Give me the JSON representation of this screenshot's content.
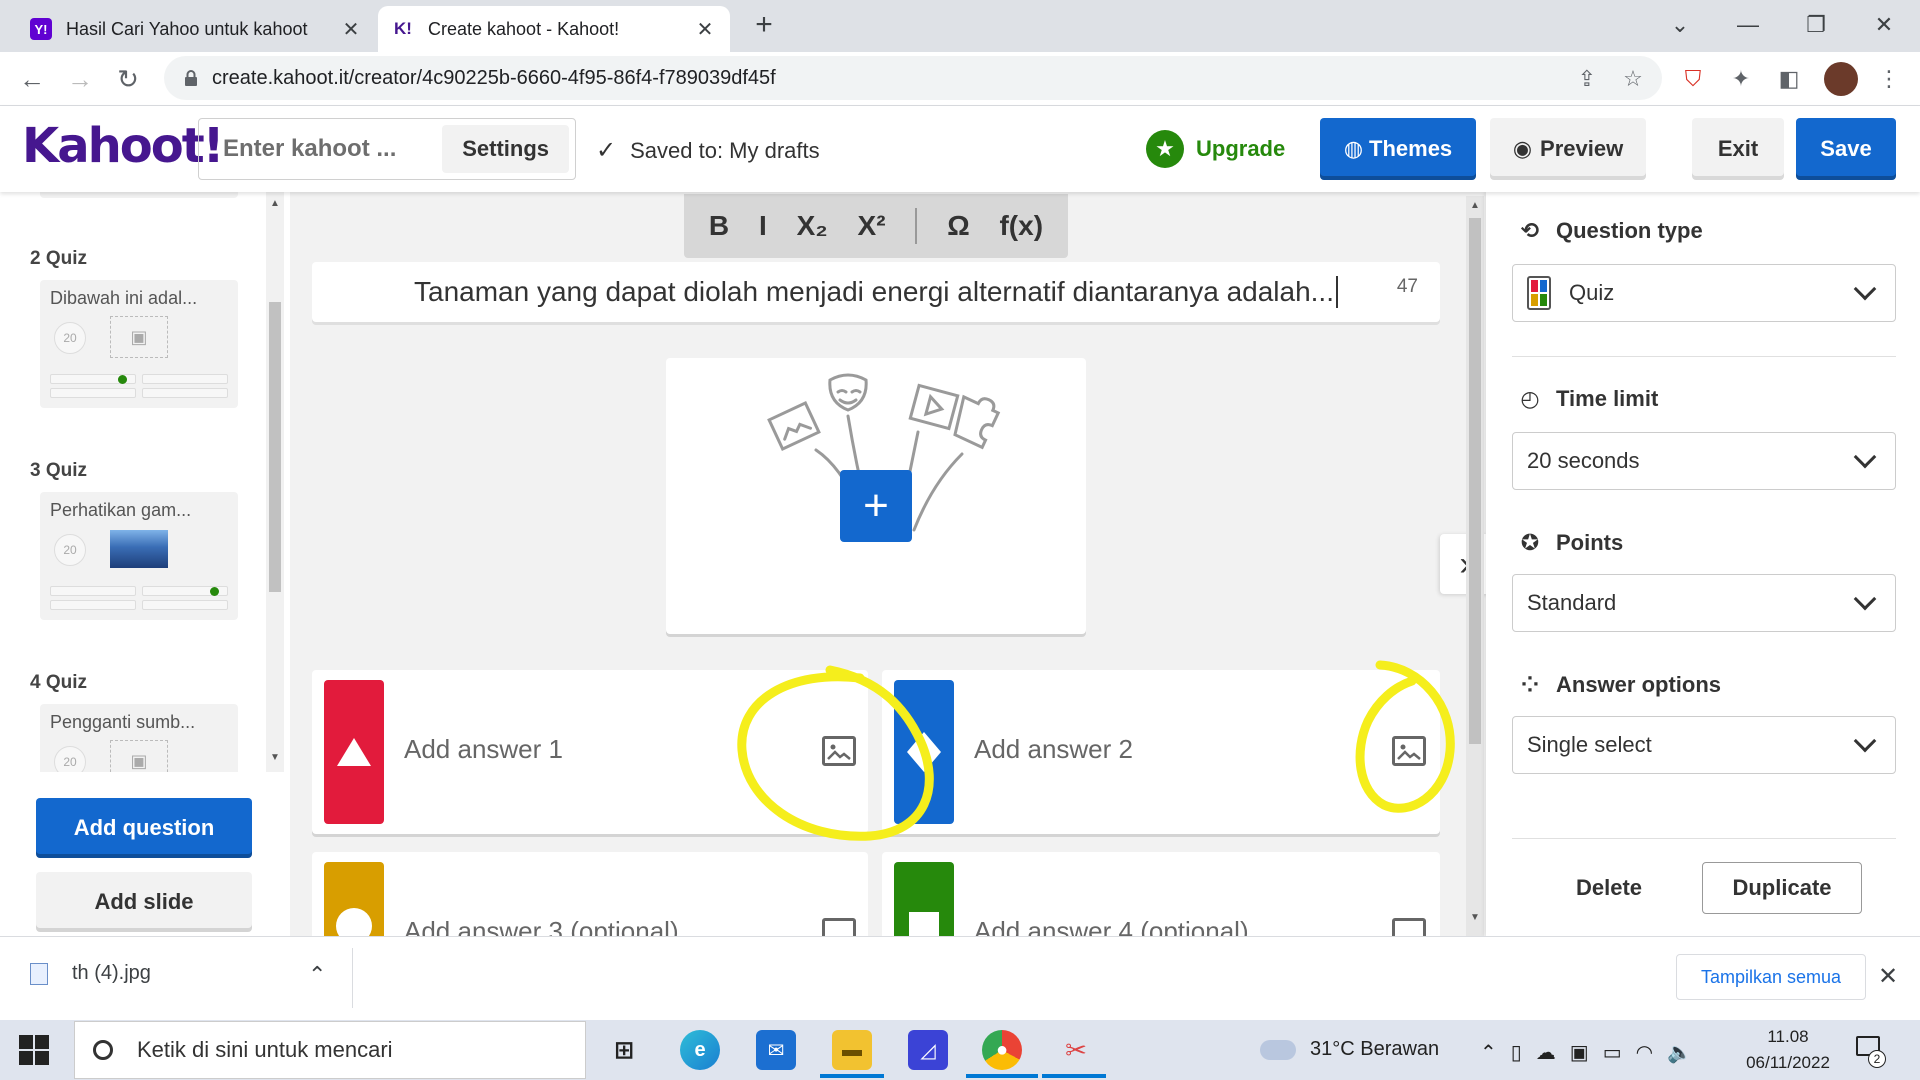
{
  "browser": {
    "tabs": [
      {
        "favicon": "Y!",
        "title": "Hasil Cari Yahoo untuk kahoot",
        "close": "✕",
        "active": false,
        "favicon_color": "#6001d2"
      },
      {
        "favicon": "K!",
        "title": "Create kahoot - Kahoot!",
        "close": "✕",
        "active": true,
        "favicon_color": "#46178f"
      }
    ],
    "new_tab": "+",
    "url": "create.kahoot.it/creator/4c90225b-6660-4f95-86f4-f789039df45f"
  },
  "header": {
    "logo": "Kahoot!",
    "title_placeholder": "Enter kahoot ...",
    "settings_label": "Settings",
    "saved_text": "Saved to: My drafts",
    "upgrade_label": "Upgrade",
    "themes_label": "Themes",
    "preview_label": "Preview",
    "exit_label": "Exit",
    "save_label": "Save"
  },
  "sidebar": {
    "slides": [
      {
        "label": "2  Quiz",
        "question": "Dibawah ini adal...",
        "time": "20",
        "has_image": false
      },
      {
        "label": "3  Quiz",
        "question": "Perhatikan gam...",
        "time": "20",
        "has_image": true
      },
      {
        "label": "4  Quiz",
        "question": "Pengganti sumb...",
        "time": "20",
        "has_image": false
      }
    ],
    "add_question_label": "Add question",
    "add_slide_label": "Add slide"
  },
  "editor": {
    "format_buttons": [
      "B",
      "I",
      "X₂",
      "X²",
      "Ω",
      "f(x)"
    ],
    "question_text": "Tanaman yang dapat diolah menjadi energi alternatif diantaranya adalah...",
    "char_count": "47",
    "answers": [
      {
        "text": "Add answer 1",
        "color": "#e21b3c",
        "shape": "triangle"
      },
      {
        "text": "Add answer 2",
        "color": "#1368ce",
        "shape": "diamond"
      },
      {
        "text": "Add answer 3 (optional)",
        "color": "#d89e00",
        "shape": "circle"
      },
      {
        "text": "Add answer 4 (optional)",
        "color": "#26890c",
        "shape": "square"
      }
    ]
  },
  "right_panel": {
    "question_type_title": "Question type",
    "question_type_value": "Quiz",
    "time_limit_title": "Time limit",
    "time_limit_value": "20 seconds",
    "points_title": "Points",
    "points_value": "Standard",
    "answer_options_title": "Answer options",
    "answer_options_value": "Single select",
    "delete_label": "Delete",
    "duplicate_label": "Duplicate"
  },
  "download_bar": {
    "file_name": "th (4).jpg",
    "show_all_label": "Tampilkan semua"
  },
  "taskbar": {
    "search_placeholder": "Ketik di sini untuk mencari",
    "weather": "31°C  Berawan",
    "time": "11.08",
    "date": "06/11/2022",
    "notification_count": "2"
  },
  "colors": {
    "kahoot_purple": "#46178f",
    "kahoot_blue": "#1368ce",
    "upgrade_green": "#26890c",
    "annotation_yellow": "#f5ee1c"
  }
}
